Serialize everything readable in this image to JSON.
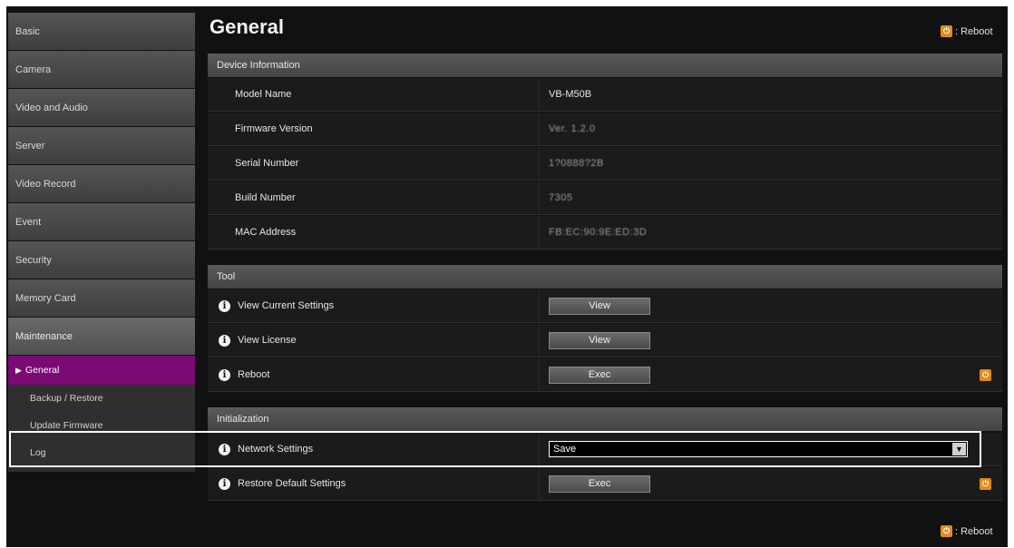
{
  "sidebar": {
    "items": [
      {
        "label": "Basic"
      },
      {
        "label": "Camera"
      },
      {
        "label": "Video and Audio"
      },
      {
        "label": "Server"
      },
      {
        "label": "Video Record"
      },
      {
        "label": "Event"
      },
      {
        "label": "Security"
      },
      {
        "label": "Memory Card"
      },
      {
        "label": "Maintenance"
      }
    ],
    "subitems": [
      {
        "label": "General"
      },
      {
        "label": "Backup / Restore"
      },
      {
        "label": "Update Firmware"
      },
      {
        "label": "Log"
      }
    ]
  },
  "header": {
    "title": "General",
    "reboot_label": ": Reboot"
  },
  "device_info": {
    "title": "Device Information",
    "rows": [
      {
        "label": "Model Name",
        "value": "VB-M50B"
      },
      {
        "label": "Firmware Version",
        "value": "Ver. 1.2.0"
      },
      {
        "label": "Serial Number",
        "value": "1?0888?2B"
      },
      {
        "label": "Build Number",
        "value": "7305"
      },
      {
        "label": "MAC Address",
        "value": "FB:EC:90:9E:ED:3D"
      }
    ]
  },
  "tool": {
    "title": "Tool",
    "rows": [
      {
        "label": "View Current Settings",
        "button": "View"
      },
      {
        "label": "View License",
        "button": "View"
      },
      {
        "label": "Reboot",
        "button": "Exec"
      }
    ]
  },
  "initialization": {
    "title": "Initialization",
    "network_settings": {
      "label": "Network Settings",
      "selected": "Save"
    },
    "restore": {
      "label": "Restore Default Settings",
      "button": "Exec"
    }
  },
  "footer": {
    "reboot_label": ": Reboot"
  },
  "colors": {
    "accent": "#7b0a74",
    "power": "#e08b1a",
    "background": "#111111"
  },
  "icons": [
    "info-icon",
    "power-icon",
    "chevron-down-icon",
    "triangle-right-icon"
  ]
}
